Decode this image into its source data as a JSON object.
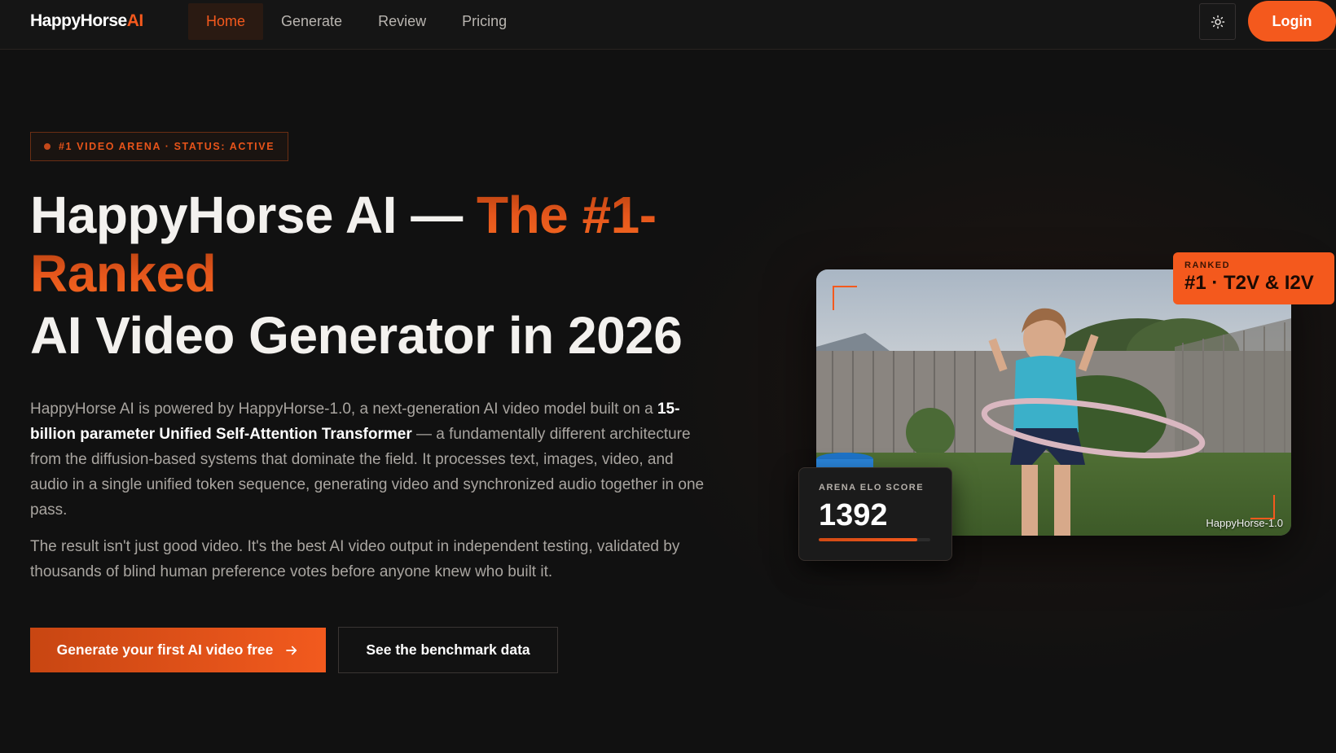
{
  "nav": {
    "logo_main": "HappyHorse",
    "logo_accent": "AI",
    "links": [
      {
        "label": "Home",
        "active": true
      },
      {
        "label": "Generate",
        "active": false
      },
      {
        "label": "Review",
        "active": false
      },
      {
        "label": "Pricing",
        "active": false
      }
    ],
    "theme_icon": "sun-icon",
    "login_label": "Login"
  },
  "hero": {
    "badge": "#1 VIDEO ARENA · STATUS: ACTIVE",
    "title_part1": "HappyHorse AI — ",
    "title_accent": "The #1-Ranked",
    "title_line2": "AI Video Generator in 2026",
    "para1_lead": "HappyHorse AI is powered by HappyHorse-1.0, a next-generation AI video model built on a ",
    "para1_bold": "15-billion parameter Unified Self-Attention Transformer",
    "para1_tail": " — a fundamentally different architecture from the diffusion-based systems that dominate the field. It processes text, images, video, and audio in a single unified token sequence, generating video and synchronized audio together in one pass.",
    "para2": "The result isn't just good video. It's the best AI video output in independent testing, validated by thousands of blind human preference votes before anyone knew who built it.",
    "cta_primary": "Generate your first AI video free",
    "cta_primary_icon": "arrow-right-icon",
    "cta_secondary": "See the benchmark data"
  },
  "showcase": {
    "video_label": "HappyHorse-1.0",
    "rank_small": "RANKED",
    "rank_big": "#1 · T2V & I2V",
    "elo_label": "ARENA ELO SCORE",
    "elo_value": "1392",
    "elo_progress": 0.88
  },
  "colors": {
    "accent": "#f4591d",
    "background": "#111111"
  }
}
